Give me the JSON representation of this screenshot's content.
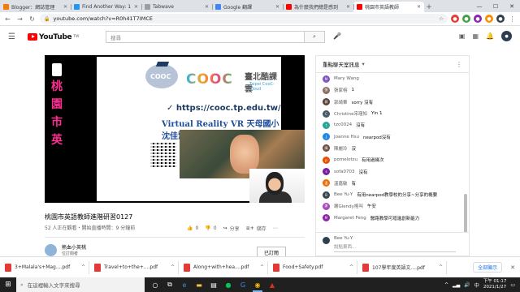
{
  "browser": {
    "tabs": [
      {
        "title": "Blogger：網誌管理",
        "color": "#f57c00",
        "active": false
      },
      {
        "title": "Find Another Way: 1",
        "color": "#2196f3",
        "active": false
      },
      {
        "title": "Tabwave",
        "color": "#9e9e9e",
        "active": false
      },
      {
        "title": "Google 翻譯",
        "color": "#4285f4",
        "active": false
      },
      {
        "title": "為什麼我們總是感到",
        "color": "#ff0000",
        "active": false
      },
      {
        "title": "桃園市英語教師",
        "color": "#ff0000",
        "active": true
      }
    ],
    "address": "youtube.com/watch?v=R0h41T7IMCE"
  },
  "youtube": {
    "logo_text": "YouTube",
    "region": "TW",
    "search_placeholder": "搜尋"
  },
  "video": {
    "title": "桃園市英語教師進階研習0127",
    "meta": "52 人正在觀看・開始直播時間：9 分鐘前",
    "likes": "0",
    "dislikes": "0",
    "share": "分享",
    "save": "儲存",
    "slide": {
      "logo": "COOC",
      "brand": "COOC",
      "cn_title": "臺北酷課雲",
      "en_title": "Taipei CooC-Cloud",
      "url": "✓ https://cooc.tp.edu.tw/",
      "subtitle": "Virtual Reality VR 天母國小沈佳慧",
      "side_text": [
        "桃",
        "園",
        "市",
        "英"
      ]
    }
  },
  "channel": {
    "name": "熱血小英桃",
    "subs": "位訂閱者",
    "join": "已訂閱"
  },
  "chat": {
    "header": "重點聊天室訊息",
    "messages": [
      {
        "author": "Mary Wang",
        "text": "",
        "color": "#7e57c2",
        "initial": "M"
      },
      {
        "author": "張家榕",
        "text": "1",
        "color": "#8d6e63",
        "initial": "張"
      },
      {
        "author": "郭綺華",
        "text": "sorry 沒有",
        "color": "#5d4037",
        "initial": "郭"
      },
      {
        "author": "Christine宋瑾知",
        "text": "Yin 1",
        "color": "#455a64",
        "initial": "C"
      },
      {
        "author": "tzc0024",
        "text": "沒有",
        "color": "#26a69a",
        "initial": "t"
      },
      {
        "author": "Joanne Hsu",
        "text": "nearpod沒有",
        "color": "#1e88e5",
        "initial": "J"
      },
      {
        "author": "陳麗玲",
        "text": "沒",
        "color": "#6d4c41",
        "initial": "陳"
      },
      {
        "author": "pomelotzu",
        "text": "有用過幾次",
        "color": "#e65100",
        "initial": "p"
      },
      {
        "author": "sofa0703",
        "text": "沒有",
        "color": "#7b1fa2",
        "initial": "s"
      },
      {
        "author": "溫嘉敏",
        "text": "有",
        "color": "#ef6c00",
        "initial": "溫"
      },
      {
        "author": "Bee Yu-Y",
        "text": "有用nearpod教學校的分享~分享的概要",
        "color": "#37474f",
        "initial": "B"
      },
      {
        "author": "謝Glendy搖叫",
        "text": "午安",
        "color": "#ab47bc",
        "initial": "謝"
      },
      {
        "author": "Margaret Feng",
        "text": "醫路教學可增進創新能力",
        "color": "#8e24aa",
        "initial": "M"
      }
    ],
    "composer_name": "Bee Yu-Y",
    "composer_placeholder": "說點東西..."
  },
  "downloads": [
    "3+Malala's+Mag....pdf",
    "Travel+to+the+....pdf",
    "Along+with+hea....pdf",
    "Food+Safety.pdf",
    "107學年度英語文....pdf"
  ],
  "downloads_show_all": "全部顯示",
  "taskbar": {
    "search_placeholder": "在這裡輸入文字來搜尋",
    "time": "下午 01:17",
    "date": "2021/1/27"
  }
}
